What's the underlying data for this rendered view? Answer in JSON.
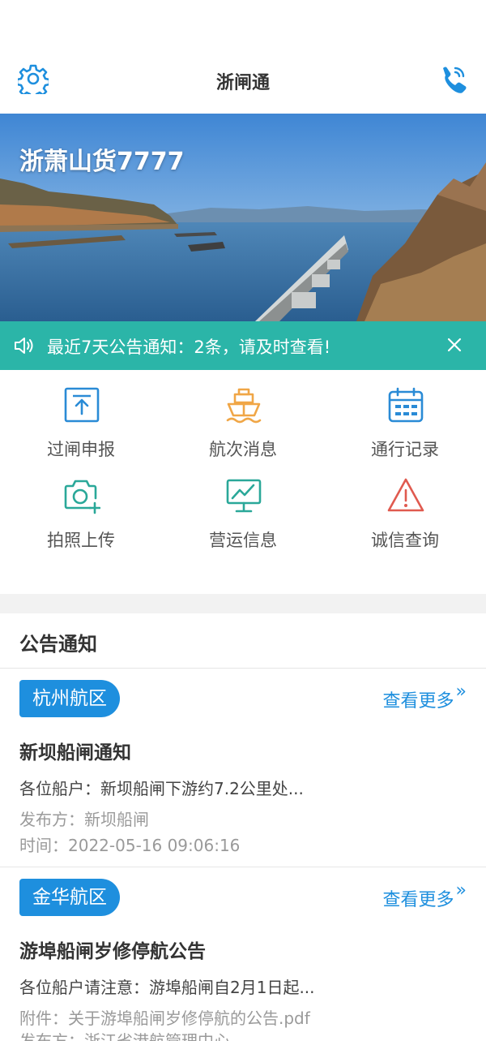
{
  "header": {
    "title": "浙闸通",
    "settings_icon": "gear-icon",
    "phone_icon": "phone-call-icon",
    "accent": "#1e8fde"
  },
  "banner": {
    "ship_name": "浙萧山货7777"
  },
  "notice_bar": {
    "text": "最近7天公告通知：2条，请及时查看!",
    "background": "#2bb5a8"
  },
  "menu": [
    {
      "label": "过闸申报",
      "icon": "upload-document-icon",
      "color": "#2a8bd6"
    },
    {
      "label": "航次消息",
      "icon": "ship-icon",
      "color": "#f0a646"
    },
    {
      "label": "通行记录",
      "icon": "calendar-icon",
      "color": "#2a8bd6"
    },
    {
      "label": "拍照上传",
      "icon": "camera-plus-icon",
      "color": "#2aa899"
    },
    {
      "label": "营运信息",
      "icon": "chart-monitor-icon",
      "color": "#2aa899"
    },
    {
      "label": "诚信查询",
      "icon": "warning-triangle-icon",
      "color": "#e05a4f"
    }
  ],
  "announcements": {
    "section_title": "公告通知",
    "more_label": "查看更多",
    "items": [
      {
        "region": "杭州航区",
        "headline": "新坝船闸通知",
        "summary": "各位船户：新坝船闸下游约7.2公里处...",
        "lines": [
          "发布方：新坝船闸",
          "时间：2022-05-16 09:06:16"
        ]
      },
      {
        "region": "金华航区",
        "headline": "游埠船闸岁修停航公告",
        "summary": "各位船户请注意：游埠船闸自2月1日起...",
        "lines": [
          "附件：关于游埠船闸岁修停航的公告.pdf",
          "发布方：浙江省港航管理中心"
        ]
      }
    ]
  }
}
